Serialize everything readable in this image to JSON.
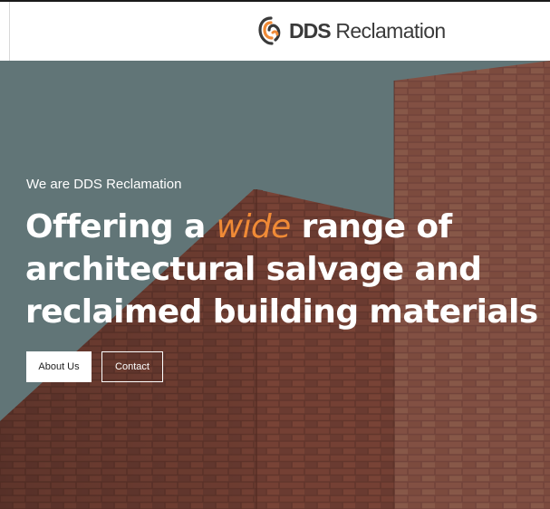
{
  "brand": {
    "name_bold": "DDS",
    "name_rest": "Reclamation",
    "logo_icon": "dds-swirl-logo-icon",
    "colors": {
      "accent": "#f08a36",
      "text_dark": "#3a3a3a",
      "sky": "#6a7f82",
      "brick": "#7d4a3d"
    }
  },
  "hero": {
    "eyebrow": "We are DDS Reclamation",
    "headline": {
      "l1_before": "Offering a ",
      "l1_accent": "wide",
      "l1_after": " range of",
      "l2": "architectural salvage and",
      "l3": "reclaimed building materials"
    },
    "buttons": {
      "about_label": "About Us",
      "contact_label": "Contact"
    }
  }
}
